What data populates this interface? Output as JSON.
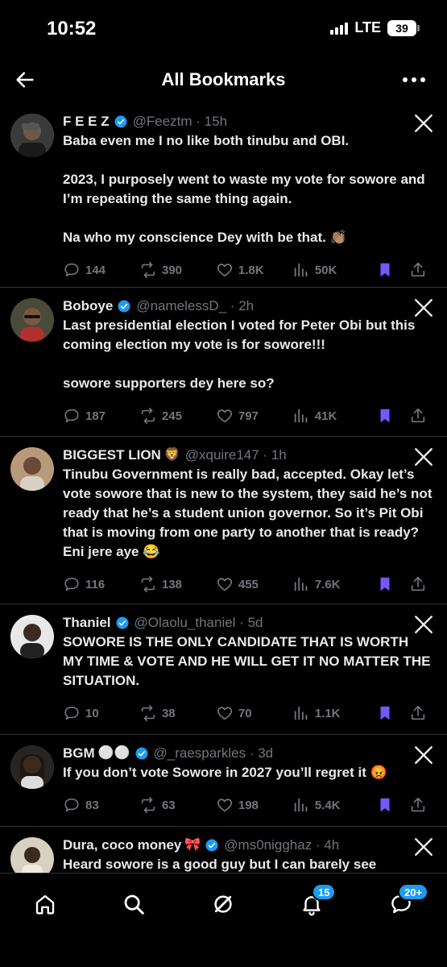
{
  "status": {
    "time": "10:52",
    "network": "LTE",
    "battery": "39"
  },
  "header": {
    "title": "All Bookmarks",
    "back_icon": "arrow-left-icon",
    "more_icon": "more-horizontal-icon"
  },
  "colors": {
    "accent": "#1d9bf0",
    "bookmark": "#7856ff",
    "muted": "#71767b",
    "divider": "#2f3336"
  },
  "tweets": [
    {
      "name": "F E E Z",
      "emoji": "",
      "handle": "@Feeztm · 15h",
      "text": "Baba even me I no like both tinubu and OBI.\n\n2023, I purposely went to waste my vote for sowore and I’m repeating the same thing again.\n\nNa who my conscience Dey with be that. 👏🏽",
      "replies": "144",
      "reposts": "390",
      "likes": "1.8K",
      "views": "50K"
    },
    {
      "name": "Boboye",
      "emoji": "",
      "handle": "@namelessD_ · 2h",
      "text": "Last presidential election I voted for Peter Obi but this coming election my vote is for sowore!!!\n\n sowore supporters dey here so?",
      "replies": "187",
      "reposts": "245",
      "likes": "797",
      "views": "41K"
    },
    {
      "name": "BIGGEST LION",
      "emoji": "🦁",
      "handle": "@xquire147 · 1h",
      "text": "Tinubu Government is really bad, accepted. Okay let’s vote sowore that is new to the system, they said he’s not ready that he’s a student union governor. So it’s Pit Obi that is moving from one party to another that is ready? Eni jere aye 😂",
      "replies": "116",
      "reposts": "138",
      "likes": "455",
      "views": "7.6K"
    },
    {
      "name": "Thaniel",
      "emoji": "",
      "handle": "@Olaolu_thaniel · 5d",
      "text": "SOWORE IS THE ONLY CANDIDATE THAT IS WORTH MY TIME & VOTE AND HE WILL GET IT NO MATTER THE SITUATION.",
      "replies": "10",
      "reposts": "38",
      "likes": "70",
      "views": "1.1K"
    },
    {
      "name": "BGM",
      "emoji": "⚪⚪",
      "handle": "@_raesparkles · 3d",
      "text": "If you don’t vote Sowore in 2027 you’ll regret it 😡",
      "replies": "83",
      "reposts": "63",
      "likes": "198",
      "views": "5.4K"
    },
    {
      "name": "Dura, coco money",
      "emoji": "🎀",
      "handle": "@ms0nigghaz · 4h",
      "text": "Heard sowore is a good guy but I can barely see",
      "replies": "",
      "reposts": "",
      "likes": "",
      "views": ""
    }
  ],
  "tabbar": {
    "notifications_badge": "15",
    "messages_badge": "20+"
  }
}
